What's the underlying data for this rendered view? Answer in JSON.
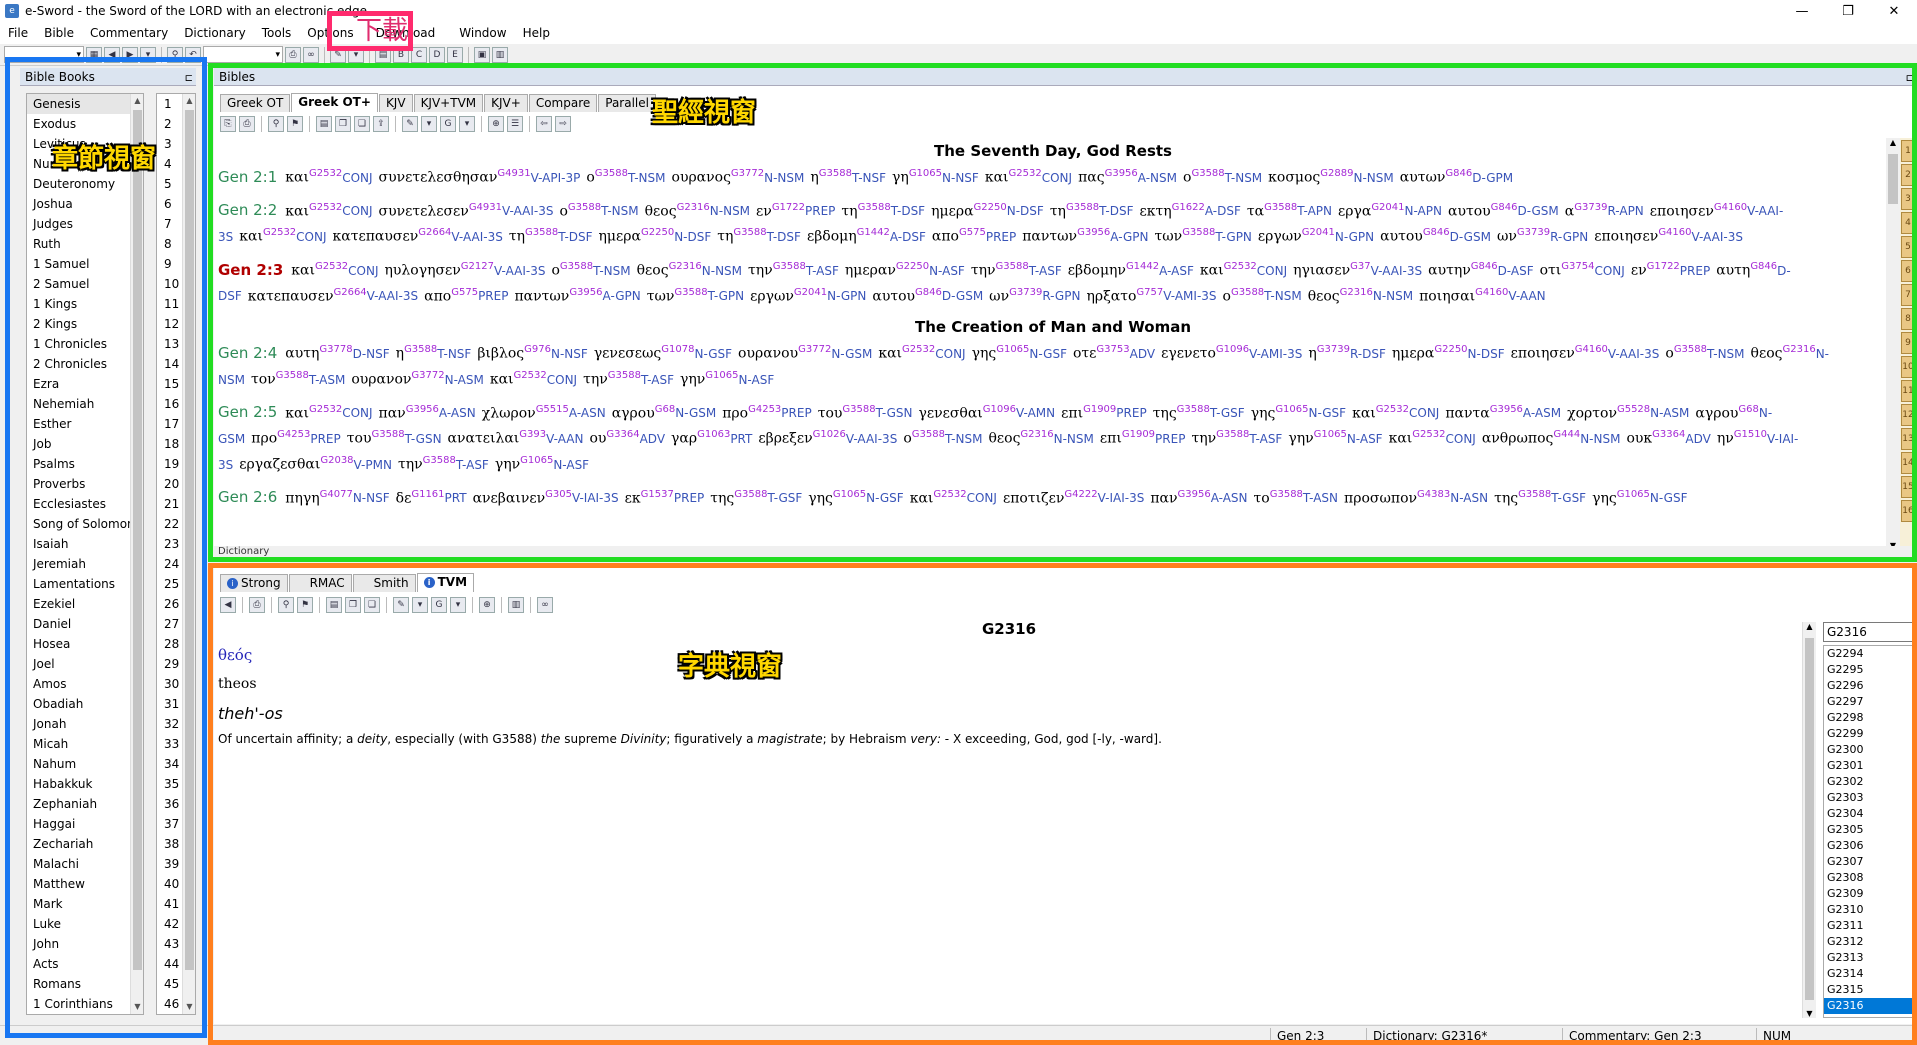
{
  "window": {
    "title": "e-Sword - the Sword of the LORD with an electronic edge",
    "controls": [
      "—",
      "❐",
      "✕"
    ]
  },
  "menu": {
    "items": [
      "File",
      "Bible",
      "Commentary",
      "Dictionary",
      "Tools",
      "Options",
      "Download",
      "Window",
      "Help"
    ]
  },
  "annotations": {
    "download": "下載",
    "books_view": "章節視窗",
    "bible_view": "聖經視窗",
    "dict_view": "字典視窗"
  },
  "colors": {
    "download_frame": "#ff2a6d",
    "books_frame": "#1877f2",
    "bible_frame": "#22dd22",
    "dict_frame": "#ff7f1e"
  },
  "books_panel": {
    "title": "Bible Books",
    "books": [
      "Genesis",
      "Exodus",
      "Leviticus",
      "Numbers",
      "Deuteronomy",
      "Joshua",
      "Judges",
      "Ruth",
      "1 Samuel",
      "2 Samuel",
      "1 Kings",
      "2 Kings",
      "1 Chronicles",
      "2 Chronicles",
      "Ezra",
      "Nehemiah",
      "Esther",
      "Job",
      "Psalms",
      "Proverbs",
      "Ecclesiastes",
      "Song of Solomon",
      "Isaiah",
      "Jeremiah",
      "Lamentations",
      "Ezekiel",
      "Daniel",
      "Hosea",
      "Joel",
      "Amos",
      "Obadiah",
      "Jonah",
      "Micah",
      "Nahum",
      "Habakkuk",
      "Zephaniah",
      "Haggai",
      "Zechariah",
      "Malachi",
      "Matthew",
      "Mark",
      "Luke",
      "John",
      "Acts",
      "Romans",
      "1 Corinthians"
    ],
    "chapters": [
      "1",
      "2",
      "3",
      "4",
      "5",
      "6",
      "7",
      "8",
      "9",
      "10",
      "11",
      "12",
      "13",
      "14",
      "15",
      "16",
      "17",
      "18",
      "19",
      "20",
      "21",
      "22",
      "23",
      "24",
      "25",
      "26",
      "27",
      "28",
      "29",
      "30",
      "31",
      "32",
      "33",
      "34",
      "35",
      "36",
      "37",
      "38",
      "39",
      "40",
      "41",
      "42",
      "43",
      "44",
      "45",
      "46"
    ]
  },
  "bible_panel": {
    "title": "Bibles",
    "tabs": [
      "Greek OT",
      "Greek OT+",
      "KJV",
      "KJV+TVM",
      "KJV+",
      "Compare",
      "Parallel"
    ],
    "active_tab": "Greek OT+",
    "bottom_tab": "Dictionary",
    "sections": [
      {
        "heading": "The Seventh Day, God Rests",
        "verses": [
          {
            "ref": "Gen 2:1",
            "current": false,
            "words": [
              [
                "και",
                "G2532",
                "CONJ"
              ],
              [
                "συνετελεσθησαν",
                "G4931",
                "V-API-3P"
              ],
              [
                "ο",
                "G3588",
                "T-NSM"
              ],
              [
                "ουρανος",
                "G3772",
                "N-NSM"
              ],
              [
                "η",
                "G3588",
                "T-NSF"
              ],
              [
                "γη",
                "G1065",
                "N-NSF"
              ],
              [
                "και",
                "G2532",
                "CONJ"
              ],
              [
                "πας",
                "G3956",
                "A-NSM"
              ],
              [
                "ο",
                "G3588",
                "T-NSM"
              ],
              [
                "κοσμος",
                "G2889",
                "N-NSM"
              ],
              [
                "αυτων",
                "G846",
                "D-GPM"
              ]
            ]
          },
          {
            "ref": "Gen 2:2",
            "current": false,
            "words": [
              [
                "και",
                "G2532",
                "CONJ"
              ],
              [
                "συνετελεσεν",
                "G4931",
                "V-AAI-3S"
              ],
              [
                "ο",
                "G3588",
                "T-NSM"
              ],
              [
                "θεος",
                "G2316",
                "N-NSM"
              ],
              [
                "εν",
                "G1722",
                "PREP"
              ],
              [
                "τη",
                "G3588",
                "T-DSF"
              ],
              [
                "ημερα",
                "G2250",
                "N-DSF"
              ],
              [
                "τη",
                "G3588",
                "T-DSF"
              ],
              [
                "εκτη",
                "G1622",
                "A-DSF"
              ],
              [
                "τα",
                "G3588",
                "T-APN"
              ],
              [
                "εργα",
                "G2041",
                "N-APN"
              ],
              [
                "αυτου",
                "G846",
                "D-GSM"
              ],
              [
                "α",
                "G3739",
                "R-APN"
              ],
              [
                "εποιησεν",
                "G4160",
                "V-AAI-3S"
              ],
              [
                "και",
                "G2532",
                "CONJ"
              ],
              [
                "κατεπαυσεν",
                "G2664",
                "V-AAI-3S"
              ],
              [
                "τη",
                "G3588",
                "T-DSF"
              ],
              [
                "ημερα",
                "G2250",
                "N-DSF"
              ],
              [
                "τη",
                "G3588",
                "T-DSF"
              ],
              [
                "εβδομη",
                "G1442",
                "A-DSF"
              ],
              [
                "απο",
                "G575",
                "PREP"
              ],
              [
                "παντων",
                "G3956",
                "A-GPN"
              ],
              [
                "των",
                "G3588",
                "T-GPN"
              ],
              [
                "εργων",
                "G2041",
                "N-GPN"
              ],
              [
                "αυτου",
                "G846",
                "D-GSM"
              ],
              [
                "ων",
                "G3739",
                "R-GPN"
              ],
              [
                "εποιησεν",
                "G4160",
                "V-AAI-3S"
              ]
            ]
          },
          {
            "ref": "Gen 2:3",
            "current": true,
            "words": [
              [
                "και",
                "G2532",
                "CONJ"
              ],
              [
                "ηυλογησεν",
                "G2127",
                "V-AAI-3S"
              ],
              [
                "ο",
                "G3588",
                "T-NSM"
              ],
              [
                "θεος",
                "G2316",
                "N-NSM"
              ],
              [
                "την",
                "G3588",
                "T-ASF"
              ],
              [
                "ημεραν",
                "G2250",
                "N-ASF"
              ],
              [
                "την",
                "G3588",
                "T-ASF"
              ],
              [
                "εβδομην",
                "G1442",
                "A-ASF"
              ],
              [
                "και",
                "G2532",
                "CONJ"
              ],
              [
                "ηγιασεν",
                "G37",
                "V-AAI-3S"
              ],
              [
                "αυτην",
                "G846",
                "D-ASF"
              ],
              [
                "οτι",
                "G3754",
                "CONJ"
              ],
              [
                "εν",
                "G1722",
                "PREP"
              ],
              [
                "αυτη",
                "G846",
                "D-DSF"
              ],
              [
                "κατεπαυσεν",
                "G2664",
                "V-AAI-3S"
              ],
              [
                "απο",
                "G575",
                "PREP"
              ],
              [
                "παντων",
                "G3956",
                "A-GPN"
              ],
              [
                "των",
                "G3588",
                "T-GPN"
              ],
              [
                "εργων",
                "G2041",
                "N-GPN"
              ],
              [
                "αυτου",
                "G846",
                "D-GSM"
              ],
              [
                "ων",
                "G3739",
                "R-GPN"
              ],
              [
                "ηρξατο",
                "G757",
                "V-AMI-3S"
              ],
              [
                "ο",
                "G3588",
                "T-NSM"
              ],
              [
                "θεος",
                "G2316",
                "N-NSM"
              ],
              [
                "ποιησαι",
                "G4160",
                "V-AAN"
              ]
            ]
          }
        ]
      },
      {
        "heading": "The Creation of Man and Woman",
        "verses": [
          {
            "ref": "Gen 2:4",
            "current": false,
            "words": [
              [
                "αυτη",
                "G3778",
                "D-NSF"
              ],
              [
                "η",
                "G3588",
                "T-NSF"
              ],
              [
                "βιβλος",
                "G976",
                "N-NSF"
              ],
              [
                "γενεσεως",
                "G1078",
                "N-GSF"
              ],
              [
                "ουρανου",
                "G3772",
                "N-GSM"
              ],
              [
                "και",
                "G2532",
                "CONJ"
              ],
              [
                "γης",
                "G1065",
                "N-GSF"
              ],
              [
                "οτε",
                "G3753",
                "ADV"
              ],
              [
                "εγενετο",
                "G1096",
                "V-AMI-3S"
              ],
              [
                "η",
                "G3739",
                "R-DSF"
              ],
              [
                "ημερα",
                "G2250",
                "N-DSF"
              ],
              [
                "εποιησεν",
                "G4160",
                "V-AAI-3S"
              ],
              [
                "ο",
                "G3588",
                "T-NSM"
              ],
              [
                "θεος",
                "G2316",
                "N-NSM"
              ],
              [
                "τον",
                "G3588",
                "T-ASM"
              ],
              [
                "ουρανον",
                "G3772",
                "N-ASM"
              ],
              [
                "και",
                "G2532",
                "CONJ"
              ],
              [
                "την",
                "G3588",
                "T-ASF"
              ],
              [
                "γην",
                "G1065",
                "N-ASF"
              ]
            ]
          },
          {
            "ref": "Gen 2:5",
            "current": false,
            "words": [
              [
                "και",
                "G2532",
                "CONJ"
              ],
              [
                "παν",
                "G3956",
                "A-ASN"
              ],
              [
                "χλωρον",
                "G5515",
                "A-ASN"
              ],
              [
                "αγρου",
                "G68",
                "N-GSM"
              ],
              [
                "προ",
                "G4253",
                "PREP"
              ],
              [
                "του",
                "G3588",
                "T-GSN"
              ],
              [
                "γενεσθαι",
                "G1096",
                "V-AMN"
              ],
              [
                "επι",
                "G1909",
                "PREP"
              ],
              [
                "της",
                "G3588",
                "T-GSF"
              ],
              [
                "γης",
                "G1065",
                "N-GSF"
              ],
              [
                "και",
                "G2532",
                "CONJ"
              ],
              [
                "παντα",
                "G3956",
                "A-ASM"
              ],
              [
                "χορτον",
                "G5528",
                "N-ASM"
              ],
              [
                "αγρου",
                "G68",
                "N-GSM"
              ],
              [
                "προ",
                "G4253",
                "PREP"
              ],
              [
                "του",
                "G3588",
                "T-GSN"
              ],
              [
                "ανατειλαι",
                "G393",
                "V-AAN"
              ],
              [
                "ου",
                "G3364",
                "ADV"
              ],
              [
                "γαρ",
                "G1063",
                "PRT"
              ],
              [
                "εβρεξεν",
                "G1026",
                "V-AAI-3S"
              ],
              [
                "ο",
                "G3588",
                "T-NSM"
              ],
              [
                "θεος",
                "G2316",
                "N-NSM"
              ],
              [
                "επι",
                "G1909",
                "PREP"
              ],
              [
                "την",
                "G3588",
                "T-ASF"
              ],
              [
                "γην",
                "G1065",
                "N-ASF"
              ],
              [
                "και",
                "G2532",
                "CONJ"
              ],
              [
                "ανθρωπος",
                "G444",
                "N-NSM"
              ],
              [
                "ουκ",
                "G3364",
                "ADV"
              ],
              [
                "ην",
                "G1510",
                "V-IAI-3S"
              ],
              [
                "εργαζεσθαι",
                "G2038",
                "V-PMN"
              ],
              [
                "την",
                "G3588",
                "T-ASF"
              ],
              [
                "γην",
                "G1065",
                "N-ASF"
              ]
            ]
          },
          {
            "ref": "Gen 2:6",
            "current": false,
            "words": [
              [
                "πηγη",
                "G4077",
                "N-NSF"
              ],
              [
                "δε",
                "G1161",
                "PRT"
              ],
              [
                "ανεβαινεν",
                "G305",
                "V-IAI-3S"
              ],
              [
                "εκ",
                "G1537",
                "PREP"
              ],
              [
                "της",
                "G3588",
                "T-GSF"
              ],
              [
                "γης",
                "G1065",
                "N-GSF"
              ],
              [
                "και",
                "G2532",
                "CONJ"
              ],
              [
                "εποτιζεν",
                "G4222",
                "V-IAI-3S"
              ],
              [
                "παν",
                "G3956",
                "A-ASN"
              ],
              [
                "το",
                "G3588",
                "T-ASN"
              ],
              [
                "προσωπον",
                "G4383",
                "N-ASN"
              ],
              [
                "της",
                "G3588",
                "T-GSF"
              ],
              [
                "γης",
                "G1065",
                "N-GSF"
              ]
            ]
          }
        ]
      }
    ]
  },
  "dict_panel": {
    "tabs": [
      "Strong",
      "RMAC",
      "Smith",
      "TVM"
    ],
    "active_tab": "TVM",
    "title": "G2316",
    "greek": "θεός",
    "translit": "theos",
    "pron": "theh'-os",
    "def_parts": [
      "Of uncertain affinity; a ",
      "deity",
      ", especially (with G3588) ",
      "the",
      " supreme ",
      "Divinity",
      "; figuratively a ",
      "magistrate",
      "; by Hebraism ",
      "very:",
      " - X exceeding, God, god [-ly, -ward]."
    ],
    "search_value": "G2316",
    "list": [
      "G2294",
      "G2295",
      "G2296",
      "G2297",
      "G2298",
      "G2299",
      "G2300",
      "G2301",
      "G2302",
      "G2303",
      "G2304",
      "G2305",
      "G2306",
      "G2307",
      "G2308",
      "G2309",
      "G2310",
      "G2311",
      "G2312",
      "G2313",
      "G2314",
      "G2315",
      "G2316"
    ],
    "selected": "G2316"
  },
  "statusbar": {
    "verse": "Gen 2:3",
    "dictionary": "Dictionary: G2316*",
    "commentary": "Commentary: Gen 2:3",
    "num": "NUM"
  }
}
